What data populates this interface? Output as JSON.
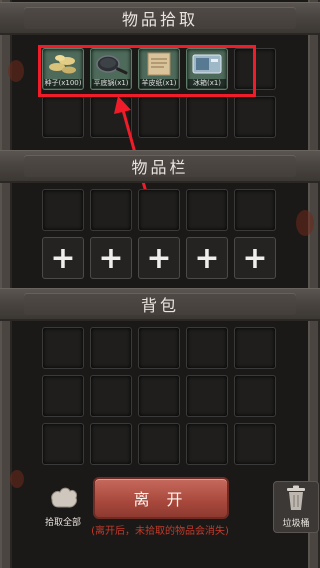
{
  "sections": {
    "pickup_title": "物品拾取",
    "inventory_title": "物品栏",
    "backpack_title": "背包"
  },
  "pickup_items": [
    {
      "label": "种子(x100)",
      "icon": "seed-bag-icon"
    },
    {
      "label": "平底锅(x1)",
      "icon": "pan-icon"
    },
    {
      "label": "羊皮纸(x1)",
      "icon": "parchment-icon"
    },
    {
      "label": "冰箱(x1)",
      "icon": "fridge-icon"
    }
  ],
  "inventory_add_symbol": "+",
  "actions": {
    "leave_label": "离 开",
    "leave_warning": "(离开后，未拾取的物品会消失)",
    "pick_all_label": "拾取全部",
    "trash_label": "垃圾桶"
  },
  "colors": {
    "highlight": "#f01c2a",
    "leave_button": "#a8483c",
    "warning_text": "#c23a2a"
  }
}
